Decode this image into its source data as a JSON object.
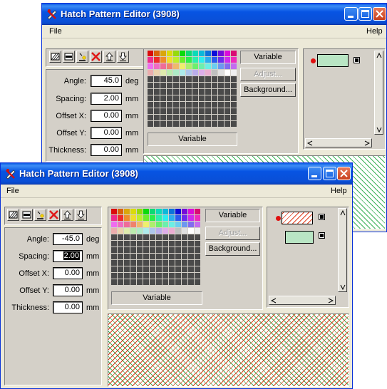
{
  "colors": {
    "titlebar": "#0a54e3",
    "face": "#d4d0c8",
    "hatch_green": "#3fb35a",
    "hatch_red": "#e04020",
    "swatch_green": "#b9e5c4"
  },
  "back_window": {
    "title": "Hatch Pattern Editor (3908)",
    "menu_file": "File",
    "menu_help": "Help",
    "angle_label": "Angle:",
    "angle_value": "45.0",
    "angle_unit": "deg",
    "spacing_label": "Spacing:",
    "spacing_value": "2.00",
    "spacing_unit": "mm",
    "offsetx_label": "Offset X:",
    "offsetx_value": "0.00",
    "offsetx_unit": "mm",
    "offsety_label": "Offset Y:",
    "offsety_value": "0.00",
    "offsety_unit": "mm",
    "thickness_label": "Thickness:",
    "thickness_value": "0.00",
    "thickness_unit": "mm",
    "variable_button": "Variable",
    "adjust_button": "Adjust...",
    "background_button": "Background...",
    "variable_field": "Variable"
  },
  "front_window": {
    "title": "Hatch Pattern Editor (3908)",
    "menu_file": "File",
    "menu_help": "Help",
    "angle_label": "Angle:",
    "angle_value": "-45.0",
    "angle_unit": "deg",
    "spacing_label": "Spacing:",
    "spacing_value": "2.00",
    "spacing_unit": "mm",
    "offsetx_label": "Offset X:",
    "offsetx_value": "0.00",
    "offsetx_unit": "mm",
    "offsety_label": "Offset Y:",
    "offsety_value": "0.00",
    "offsety_unit": "mm",
    "thickness_label": "Thickness:",
    "thickness_value": "0.00",
    "thickness_unit": "mm",
    "variable_button": "Variable",
    "adjust_button": "Adjust...",
    "background_button": "Background...",
    "variable_field": "Variable"
  }
}
